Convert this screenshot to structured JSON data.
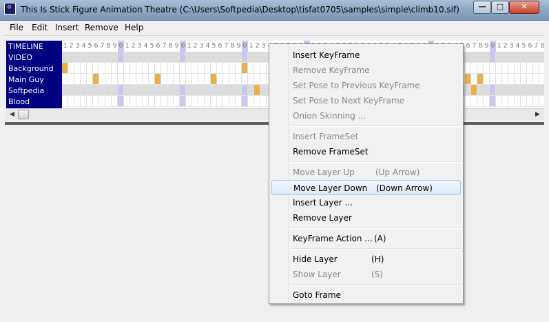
{
  "window": {
    "title": "This Is Stick Figure Animation Theatre (C:\\Users\\Softpedia\\Desktop\\tisfat0705\\samples\\simple\\climb10.sif)",
    "icon_label": "TISFAT",
    "buttons": {
      "minimize": "—",
      "maximize": "□",
      "close": "✕"
    }
  },
  "menubar": [
    "File",
    "Edit",
    "Insert",
    "Remove",
    "Help"
  ],
  "timeline": {
    "layers": [
      "TIMELINE",
      "VIDEO",
      "Background",
      "Main Guy",
      "Softpedia",
      "Blood"
    ],
    "frame_digits": "1234567890"
  },
  "context_menu": {
    "items": [
      {
        "label": "Insert KeyFrame",
        "shortcut": "",
        "enabled": true
      },
      {
        "label": "Remove KeyFrame",
        "shortcut": "",
        "enabled": false
      },
      {
        "label": "Set Pose to Previous KeyFrame",
        "shortcut": "",
        "enabled": false
      },
      {
        "label": "Set Pose to Next KeyFrame",
        "shortcut": "",
        "enabled": false
      },
      {
        "label": "Onion Skinning ...",
        "shortcut": "",
        "enabled": false
      },
      {
        "separator": true
      },
      {
        "label": "Insert FrameSet",
        "shortcut": "",
        "enabled": false
      },
      {
        "label": "Remove FrameSet",
        "shortcut": "",
        "enabled": true
      },
      {
        "separator": true
      },
      {
        "label": "Move Layer Up",
        "shortcut": "(Up Arrow)",
        "enabled": false
      },
      {
        "label": "Move Layer Down",
        "shortcut": "(Down Arrow)",
        "enabled": true,
        "highlighted": true
      },
      {
        "label": "Insert Layer ...",
        "shortcut": "",
        "enabled": true
      },
      {
        "label": "Remove Layer",
        "shortcut": "",
        "enabled": true
      },
      {
        "separator": true
      },
      {
        "label": "KeyFrame Action ...",
        "shortcut": "(A)",
        "enabled": true
      },
      {
        "separator": true
      },
      {
        "label": "Hide Layer",
        "shortcut": "(H)",
        "enabled": true
      },
      {
        "label": "Show Layer",
        "shortcut": "(S)",
        "enabled": false
      },
      {
        "separator": true
      },
      {
        "label": "Goto Frame",
        "shortcut": "",
        "enabled": true
      }
    ]
  },
  "colors": {
    "layer_column": "#000080",
    "keyframe": "#e8b04a",
    "frame_marker": "#c8c8f0",
    "hidden_cell": "#dcdcdc"
  }
}
